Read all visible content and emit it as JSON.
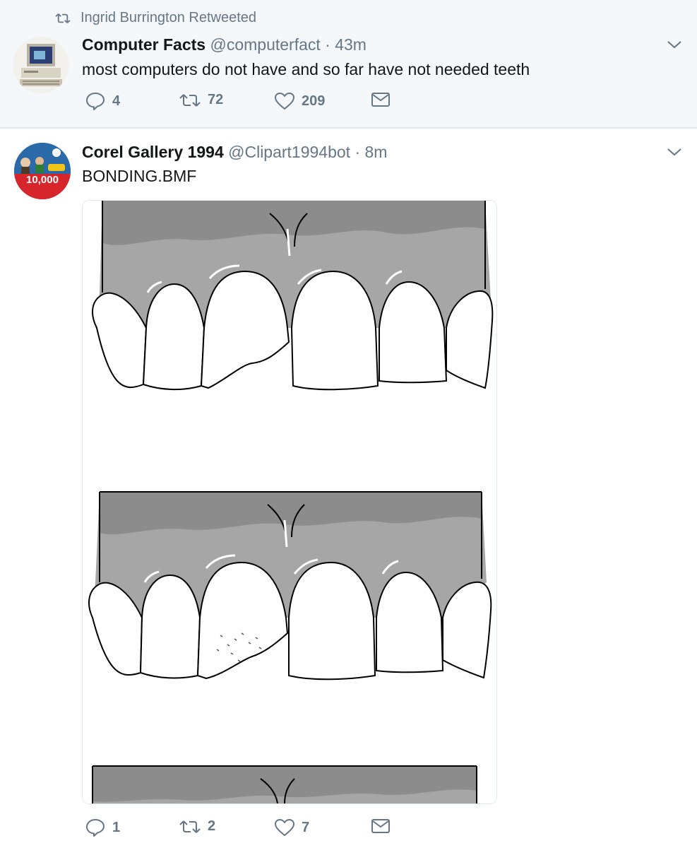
{
  "retweet_context": {
    "text": "Ingrid Burrington Retweeted"
  },
  "tweets": [
    {
      "name": "Computer Facts",
      "handle": "@computerfact",
      "time": "· 43m",
      "text": "most computers do not have and so far have not needed teeth",
      "reply_count": "4",
      "retweet_count": "72",
      "like_count": "209"
    },
    {
      "name": "Corel Gallery 1994",
      "handle": "@Clipart1994bot",
      "time": "· 8m",
      "text": "BONDING.BMF",
      "avatar_badge": "10,000",
      "reply_count": "1",
      "retweet_count": "2",
      "like_count": "7"
    }
  ],
  "icons": [
    "retweet-icon",
    "reply-icon",
    "like-icon",
    "dm-icon",
    "caret-down-icon"
  ],
  "colors": {
    "muted": "#657786",
    "text": "#14171a",
    "context_bg": "#f5f8fa",
    "border": "#e1e8ed"
  }
}
